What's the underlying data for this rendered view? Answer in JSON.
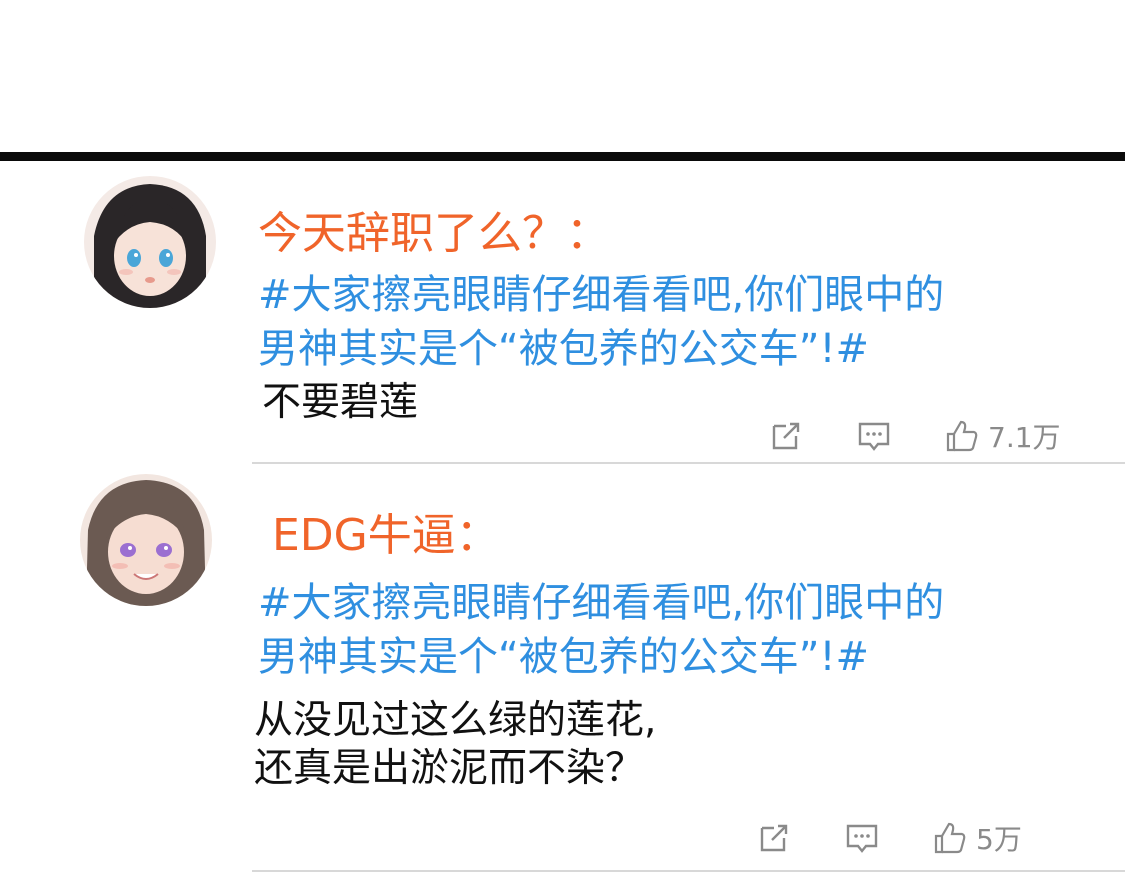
{
  "comments": [
    {
      "username": "今天辞职了么？：",
      "hashtag_line1": "#大家擦亮眼睛仔细看看吧,你们眼中的",
      "hashtag_line2": "男神其实是个“被包养的公交车”!#",
      "body_line1": "不要碧莲",
      "body_line2": "",
      "like_count": "7.1万",
      "avatar": {
        "hair": "#2a2628",
        "eye": "#4aa6d8",
        "skin": "#f7e2d8"
      }
    },
    {
      "username": "EDG牛逼：",
      "hashtag_line1": "#大家擦亮眼睛仔细看看吧,你们眼中的",
      "hashtag_line2": "男神其实是个“被包养的公交车”!#",
      "body_line1": "从没见过这么绿的莲花,",
      "body_line2": "还真是出淤泥而不染？",
      "like_count": "5万",
      "avatar": {
        "hair": "#6b5a52",
        "eye": "#9b6fd1",
        "skin": "#f6ddd2"
      }
    }
  ],
  "icons": {
    "share": "share-icon",
    "comment": "comment-icon",
    "like": "thumbs-up-icon"
  },
  "colors": {
    "username": "#f0642a",
    "hashtag": "#2f8fe0",
    "body": "#111111",
    "meta": "#8a8a8a",
    "divider": "#0a0a0a"
  }
}
